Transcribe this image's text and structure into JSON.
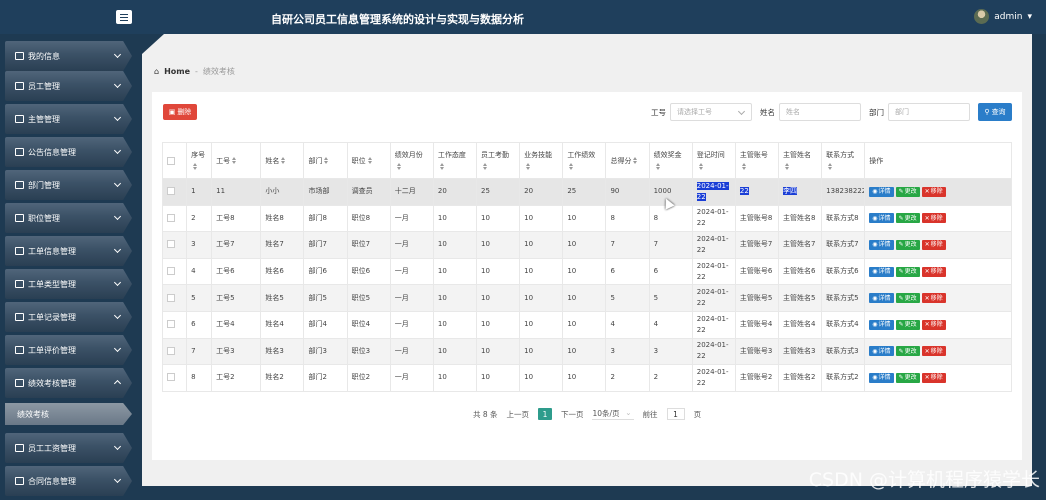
{
  "header": {
    "title": "自研公司员工信息管理系统的设计与实现与数据分析",
    "user": "admin"
  },
  "sidebar": {
    "items": [
      {
        "label": "我的信息",
        "icon": "id-card-icon"
      },
      {
        "label": "员工管理",
        "icon": "grid-icon"
      },
      {
        "label": "主管管理",
        "icon": "list-icon"
      },
      {
        "label": "公告信息管理",
        "icon": "doc-icon"
      },
      {
        "label": "部门管理",
        "icon": "sliders-icon"
      },
      {
        "label": "职位管理",
        "icon": "grid-icon"
      },
      {
        "label": "工单信息管理",
        "icon": "grid-icon"
      },
      {
        "label": "工单类型管理",
        "icon": "file-icon"
      },
      {
        "label": "工单记录管理",
        "icon": "grid-icon"
      },
      {
        "label": "工单评价管理",
        "icon": "monitor-icon"
      },
      {
        "label": "绩效考核管理",
        "icon": "doc-icon"
      },
      {
        "label": "员工工资管理",
        "icon": "user-icon"
      },
      {
        "label": "合同信息管理",
        "icon": "doc-icon"
      }
    ],
    "sub_item": "绩效考核"
  },
  "breadcrumb": {
    "home": "Home",
    "sep": "-",
    "current": "绩效考核"
  },
  "toolbar": {
    "delete": "删除",
    "search": "查询"
  },
  "search": {
    "job_no_label": "工号",
    "job_no_placeholder": "请选择工号",
    "name_label": "姓名",
    "name_placeholder": "姓名",
    "dept_label": "部门",
    "dept_placeholder": "部门"
  },
  "table": {
    "headers": [
      "序号",
      "工号",
      "姓名",
      "部门",
      "职位",
      "绩效月份",
      "工作态度",
      "员工考勤",
      "业务技能",
      "工作绩效",
      "总得分",
      "绩效奖金",
      "登记时间",
      "主管账号",
      "主管姓名",
      "联系方式",
      "操作"
    ],
    "rows": [
      [
        "1",
        "11",
        "小小",
        "市场部",
        "调查员",
        "十二月",
        "20",
        "25",
        "20",
        "25",
        "90",
        "1000",
        "2024-01-22",
        "22",
        "李四",
        "13823822222"
      ],
      [
        "2",
        "工号8",
        "姓名8",
        "部门8",
        "职位8",
        "一月",
        "10",
        "10",
        "10",
        "10",
        "8",
        "8",
        "2024-01-22",
        "主管账号8",
        "主管姓名8",
        "联系方式8"
      ],
      [
        "3",
        "工号7",
        "姓名7",
        "部门7",
        "职位7",
        "一月",
        "10",
        "10",
        "10",
        "10",
        "7",
        "7",
        "2024-01-22",
        "主管账号7",
        "主管姓名7",
        "联系方式7"
      ],
      [
        "4",
        "工号6",
        "姓名6",
        "部门6",
        "职位6",
        "一月",
        "10",
        "10",
        "10",
        "10",
        "6",
        "6",
        "2024-01-22",
        "主管账号6",
        "主管姓名6",
        "联系方式6"
      ],
      [
        "5",
        "工号5",
        "姓名5",
        "部门5",
        "职位5",
        "一月",
        "10",
        "10",
        "10",
        "10",
        "5",
        "5",
        "2024-01-22",
        "主管账号5",
        "主管姓名5",
        "联系方式5"
      ],
      [
        "6",
        "工号4",
        "姓名4",
        "部门4",
        "职位4",
        "一月",
        "10",
        "10",
        "10",
        "10",
        "4",
        "4",
        "2024-01-22",
        "主管账号4",
        "主管姓名4",
        "联系方式4"
      ],
      [
        "7",
        "工号3",
        "姓名3",
        "部门3",
        "职位3",
        "一月",
        "10",
        "10",
        "10",
        "10",
        "3",
        "3",
        "2024-01-22",
        "主管账号3",
        "主管姓名3",
        "联系方式3"
      ],
      [
        "8",
        "工号2",
        "姓名2",
        "部门2",
        "职位2",
        "一月",
        "10",
        "10",
        "10",
        "10",
        "2",
        "2",
        "2024-01-22",
        "主管账号2",
        "主管姓名2",
        "联系方式2"
      ]
    ],
    "actions": {
      "detail": "详情",
      "edit": "更改",
      "remove": "移除"
    }
  },
  "pagination": {
    "total": "共 8 条",
    "prev": "上一页",
    "page": "1",
    "next": "下一页",
    "size": "10条/页",
    "goto": "前往",
    "goto_page": "1",
    "page_unit": "页"
  },
  "watermark": "CSDN @计算机程序猿学长",
  "colors": {
    "topbar": "#1f3f5c",
    "delete": "#e0473a",
    "search": "#2a7dc9",
    "detail": "#2a7dc9",
    "edit": "#28a745",
    "remove": "#d9342b",
    "page_active": "#2e9c8c"
  }
}
